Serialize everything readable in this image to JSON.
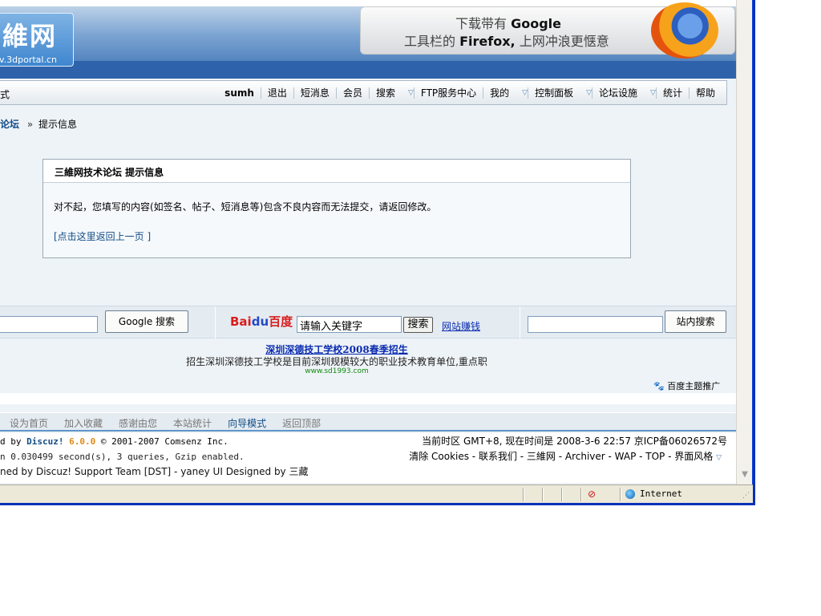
{
  "header": {
    "logo_text": "維网",
    "logo_url": "v.3dportal.cn",
    "ad_line1_prefix": "下载带有",
    "ad_line1_brand": "Google",
    "ad_line2_prefix": "工具栏的",
    "ad_line2_brand": "Firefox,",
    "ad_line2_suffix": "上网冲浪更惬意"
  },
  "nav": {
    "left_fragment": "式",
    "items": [
      {
        "label": "sumh"
      },
      {
        "label": "退出"
      },
      {
        "label": "短消息"
      },
      {
        "label": "会员"
      },
      {
        "label": "搜索",
        "dropdown": true
      },
      {
        "label": "FTP服务中心"
      },
      {
        "label": "我的",
        "dropdown": true
      },
      {
        "label": "控制面板",
        "dropdown": true
      },
      {
        "label": "论坛设施",
        "dropdown": true
      },
      {
        "label": "统计"
      },
      {
        "label": "帮助"
      }
    ],
    "arrow_glyph": "▽"
  },
  "breadcrumb": {
    "forum": "论坛",
    "sep": "»",
    "current": "提示信息"
  },
  "message": {
    "title": "三維网技术论坛  提示信息",
    "text": "对不起，您填写的内容(如签名、帖子、短消息等)包含不良内容而无法提交，请返回修改。",
    "back_link": "[点击这里返回上一页 ]"
  },
  "search": {
    "google_button": "Google 搜索",
    "baidu_logo_left": "Bai",
    "baidu_logo_paw": "du",
    "baidu_logo_right": "百度",
    "baidu_input_value": "请输入关键字",
    "baidu_button": "搜索",
    "baidu_earn": "网站赚钱",
    "site_button": "站内搜索"
  },
  "promo": {
    "title": "深圳深德技工学校2008春季招生",
    "desc": "招生深圳深德技工学校是目前深圳规模较大的职业技术教育单位,重点职",
    "url": "www.sd1993.com",
    "baidu_promo": "百度主题推广"
  },
  "footer_nav": {
    "links": [
      {
        "label": "设为首页",
        "active": false
      },
      {
        "label": "加入收藏",
        "active": false
      },
      {
        "label": "感谢由您",
        "active": false
      },
      {
        "label": "本站统计",
        "active": false
      },
      {
        "label": "向导模式",
        "active": true
      },
      {
        "label": "返回顶部",
        "active": false
      }
    ]
  },
  "footer": {
    "powered_prefix": "d by",
    "powered_brand": "Discuz!",
    "powered_version": "6.0.0",
    "powered_suffix": "© 2001-2007 Comsenz Inc.",
    "processed": "n 0.030499 second(s), 3 queries, Gzip enabled.",
    "designed": "ned by Discuz! Support Team [DST] - yaney UI Designed by 三藏",
    "timezone": "当前时区  GMT+8, 现在时间是  2008-3-6 22:57 京ICP备06026572号",
    "tools": "清除  Cookies - 联系我们  - 三維网  - Archiver - WAP - TOP - 界面风格",
    "tools_chev": "▽"
  },
  "status": {
    "zone": "Internet"
  },
  "colors": {
    "link_blue": "#114c85",
    "accent_orange": "#e18a17",
    "window_frame": "#0a46d8"
  }
}
